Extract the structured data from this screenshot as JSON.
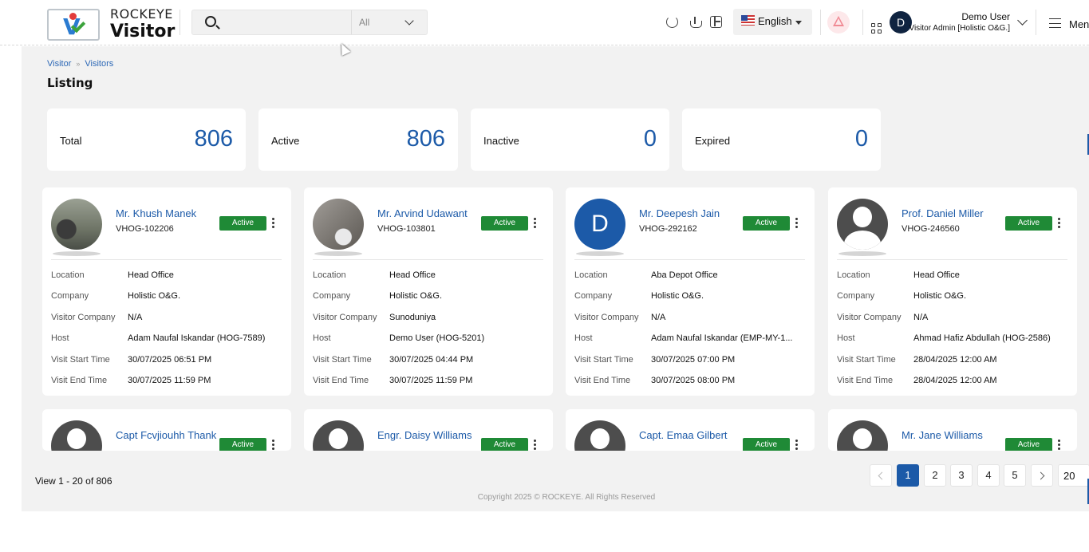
{
  "header": {
    "brand": "ROCKEYE",
    "product": "Visitor",
    "search_placeholder": "",
    "search_scope": "All",
    "language": "English",
    "user_initial": "D",
    "user_name": "Demo User",
    "user_role": "Visitor Admin [Holistic O&G.]",
    "menu_label": "Menu"
  },
  "breadcrumb": {
    "root": "Visitor",
    "current": "Visitors"
  },
  "page_title": "Listing",
  "stats": [
    {
      "label": "Total",
      "value": "806"
    },
    {
      "label": "Active",
      "value": "806"
    },
    {
      "label": "Inactive",
      "value": "0"
    },
    {
      "label": "Expired",
      "value": "0"
    }
  ],
  "field_labels": {
    "location": "Location",
    "company": "Company",
    "visitor_company": "Visitor Company",
    "host": "Host",
    "start": "Visit Start Time",
    "end": "Visit End Time"
  },
  "cards": [
    {
      "name": "Mr. Khush Manek",
      "id": "VHOG-102206",
      "status": "Active",
      "location": "Head Office",
      "company": "Holistic O&G.",
      "visitor_company": "N/A",
      "host": "Adam Naufal Iskandar (HOG-7589)",
      "start": "30/07/2025 06:51 PM",
      "end": "30/07/2025 11:59 PM"
    },
    {
      "name": "Mr. Arvind Udawant",
      "id": "VHOG-103801",
      "status": "Active",
      "location": "Head Office",
      "company": "Holistic O&G.",
      "visitor_company": "Sunoduniya",
      "host": "Demo User (HOG-5201)",
      "start": "30/07/2025 04:44 PM",
      "end": "30/07/2025 11:59 PM"
    },
    {
      "name": "Mr. Deepesh Jain",
      "id": "VHOG-292162",
      "initial": "D",
      "status": "Active",
      "location": "Aba Depot Office",
      "company": "Holistic O&G.",
      "visitor_company": "N/A",
      "host": "Adam Naufal Iskandar (EMP-MY-1...",
      "start": "30/07/2025 07:00 PM",
      "end": "30/07/2025 08:00 PM"
    },
    {
      "name": "Prof. Daniel Miller",
      "id": "VHOG-246560",
      "status": "Active",
      "location": "Head Office",
      "company": "Holistic O&G.",
      "visitor_company": "N/A",
      "host": "Ahmad Hafiz Abdullah (HOG-2586)",
      "start": "28/04/2025 12:00 AM",
      "end": "28/04/2025 12:00 AM"
    }
  ],
  "cards_partial": [
    {
      "name": "Capt Fcvjiouhh Thank",
      "status": "Active"
    },
    {
      "name": "Engr. Daisy Williams",
      "status": "Active"
    },
    {
      "name": "Capt. Emaa Gilbert",
      "status": "Active"
    },
    {
      "name": "Mr. Jane Williams",
      "status": "Active"
    }
  ],
  "pagination": {
    "view_text": "View 1 - 20 of 806",
    "pages": [
      "1",
      "2",
      "3",
      "4",
      "5"
    ],
    "current": "1",
    "page_size": "20"
  },
  "copyright": "Copyright 2025 © ROCKEYE. All Rights Reserved"
}
